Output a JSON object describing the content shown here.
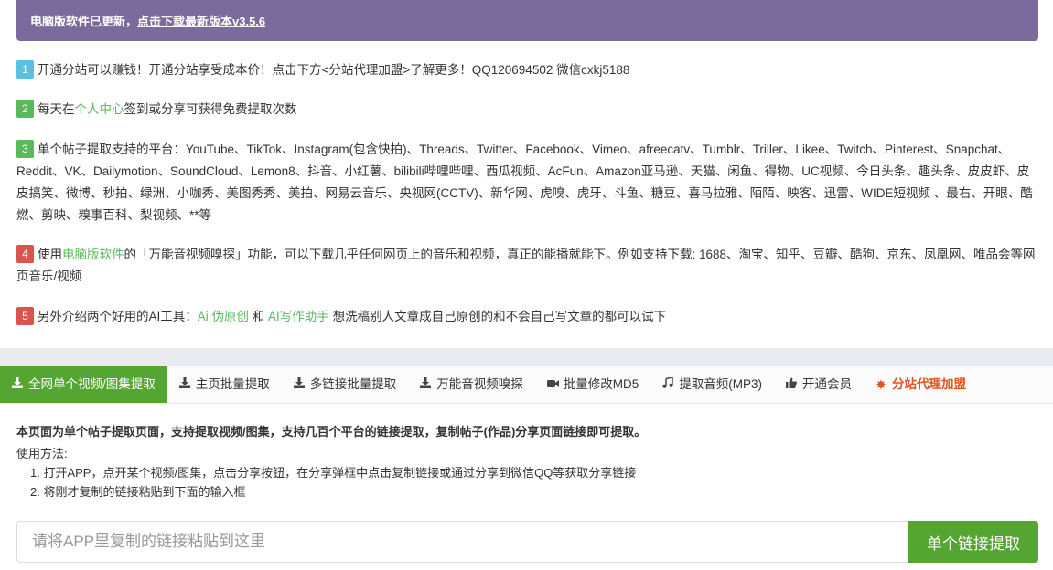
{
  "banner": {
    "text": "电脑版软件已更新，",
    "link": "点击下载最新版本v3.5.6"
  },
  "notices": [
    {
      "num": "1",
      "text": "开通分站可以赚钱！开通分站享受成本价！点击下方<分站代理加盟>了解更多！QQ120694502 微信cxkj5188"
    },
    {
      "num": "2",
      "pre": "每天在",
      "link": "个人中心",
      "post": "签到或分享可获得免费提取次数"
    },
    {
      "num": "3",
      "text": "单个帖子提取支持的平台：YouTube、TikTok、Instagram(包含快拍)、Threads、Twitter、Facebook、Vimeo、afreecatv、Tumblr、Triller、Likee、Twitch、Pinterest、Snapchat、Reddit、VK、Dailymotion、SoundCloud、Lemon8、抖音、小红薯、bilibili哔哩哔哩、西瓜视频、AcFun、Amazon亚马逊、天猫、闲鱼、得物、UC视频、今日头条、趣头条、皮皮虾、皮皮搞笑、微博、秒拍、绿洲、小咖秀、美图秀秀、美拍、网易云音乐、央视网(CCTV)、新华网、虎嗅、虎牙、斗鱼、糖豆、喜马拉雅、陌陌、映客、迅雷、WIDE短视频 、最右、开眼、酷燃、剪映、糗事百科、梨视频、**等"
    },
    {
      "num": "4",
      "pre": "使用",
      "link": "电脑版软件",
      "post": "的「万能音视频嗅探」功能，可以下载几乎任何网页上的音乐和视频，真正的能播就能下。例如支持下载: 1688、淘宝、知乎、豆瓣、酷狗、京东、凤凰网、唯品会等网页音乐/视频"
    },
    {
      "num": "5",
      "pre": "另外介绍两个好用的AI工具：",
      "link1": "Ai 伪原创",
      "mid": " 和 ",
      "link2": "AI写作助手",
      "post": " 想洗稿别人文章成自己原创的和不会自己写文章的都可以试下"
    }
  ],
  "tabs": [
    {
      "label": "全网单个视频/图集提取",
      "icon": "download-icon"
    },
    {
      "label": "主页批量提取",
      "icon": "download-icon"
    },
    {
      "label": "多链接批量提取",
      "icon": "download-icon"
    },
    {
      "label": "万能音视频嗅探",
      "icon": "download-icon"
    },
    {
      "label": "批量修改MD5",
      "icon": "video-camera-icon"
    },
    {
      "label": "提取音频(MP3)",
      "icon": "music-note-icon"
    },
    {
      "label": "开通会员",
      "icon": "thumbs-up-icon"
    },
    {
      "label": "分站代理加盟",
      "icon": "star-icon"
    }
  ],
  "info": {
    "title": "本页面为单个帖子提取页面，支持提取视频/图集，支持几百个平台的链接提取，复制帖子(作品)分享页面链接即可提取。",
    "usage_label": "使用方法:",
    "steps": [
      "1. 打开APP，点开某个视频/图集，点击分享按钮，在分享弹框中点击复制链接或通过分享到微信QQ等获取分享链接",
      "2. 将刚才复制的链接粘贴到下面的输入框"
    ]
  },
  "search": {
    "placeholder": "请将APP里复制的链接粘贴到这里",
    "button": "单个链接提取"
  },
  "colors": {
    "banner": "#7b6b9d",
    "accent_green": "#55a532",
    "badge_blue": "#5bc0de",
    "badge_green": "#5cb85c",
    "badge_red": "#d9534f",
    "tab_red": "#e2521d"
  }
}
